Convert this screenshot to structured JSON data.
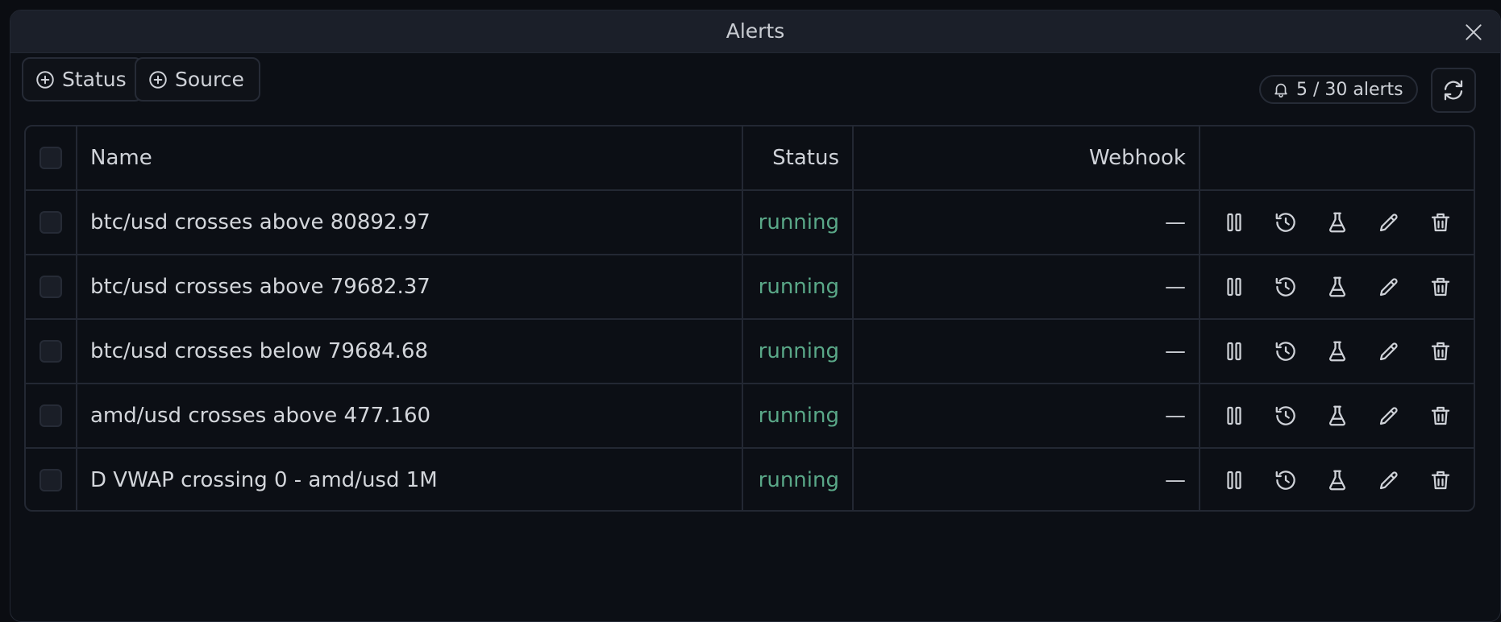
{
  "window": {
    "title": "Alerts"
  },
  "filters": [
    {
      "label": "Status",
      "icon": "plus-circle-icon"
    },
    {
      "label": "Source",
      "icon": "plus-circle-icon"
    }
  ],
  "counter": {
    "label": "5 / 30 alerts",
    "icon": "bell-icon"
  },
  "table": {
    "headers": {
      "name": "Name",
      "status": "Status",
      "webhook": "Webhook"
    },
    "rows": [
      {
        "name": "btc/usd crosses above 80892.97",
        "status": "running",
        "webhook": "—"
      },
      {
        "name": "btc/usd crosses above 79682.37",
        "status": "running",
        "webhook": "—"
      },
      {
        "name": "btc/usd crosses below 79684.68",
        "status": "running",
        "webhook": "—"
      },
      {
        "name": "amd/usd crosses above 477.160",
        "status": "running",
        "webhook": "—"
      },
      {
        "name": "D VWAP crossing 0 - amd/usd 1M",
        "status": "running",
        "webhook": "—"
      }
    ],
    "row_actions": [
      "pause-icon",
      "history-icon",
      "flask-icon",
      "pencil-icon",
      "trash-icon"
    ]
  },
  "colors": {
    "running": "#5aa888",
    "background": "#0c0f15",
    "titlebar": "#1b1f29"
  }
}
